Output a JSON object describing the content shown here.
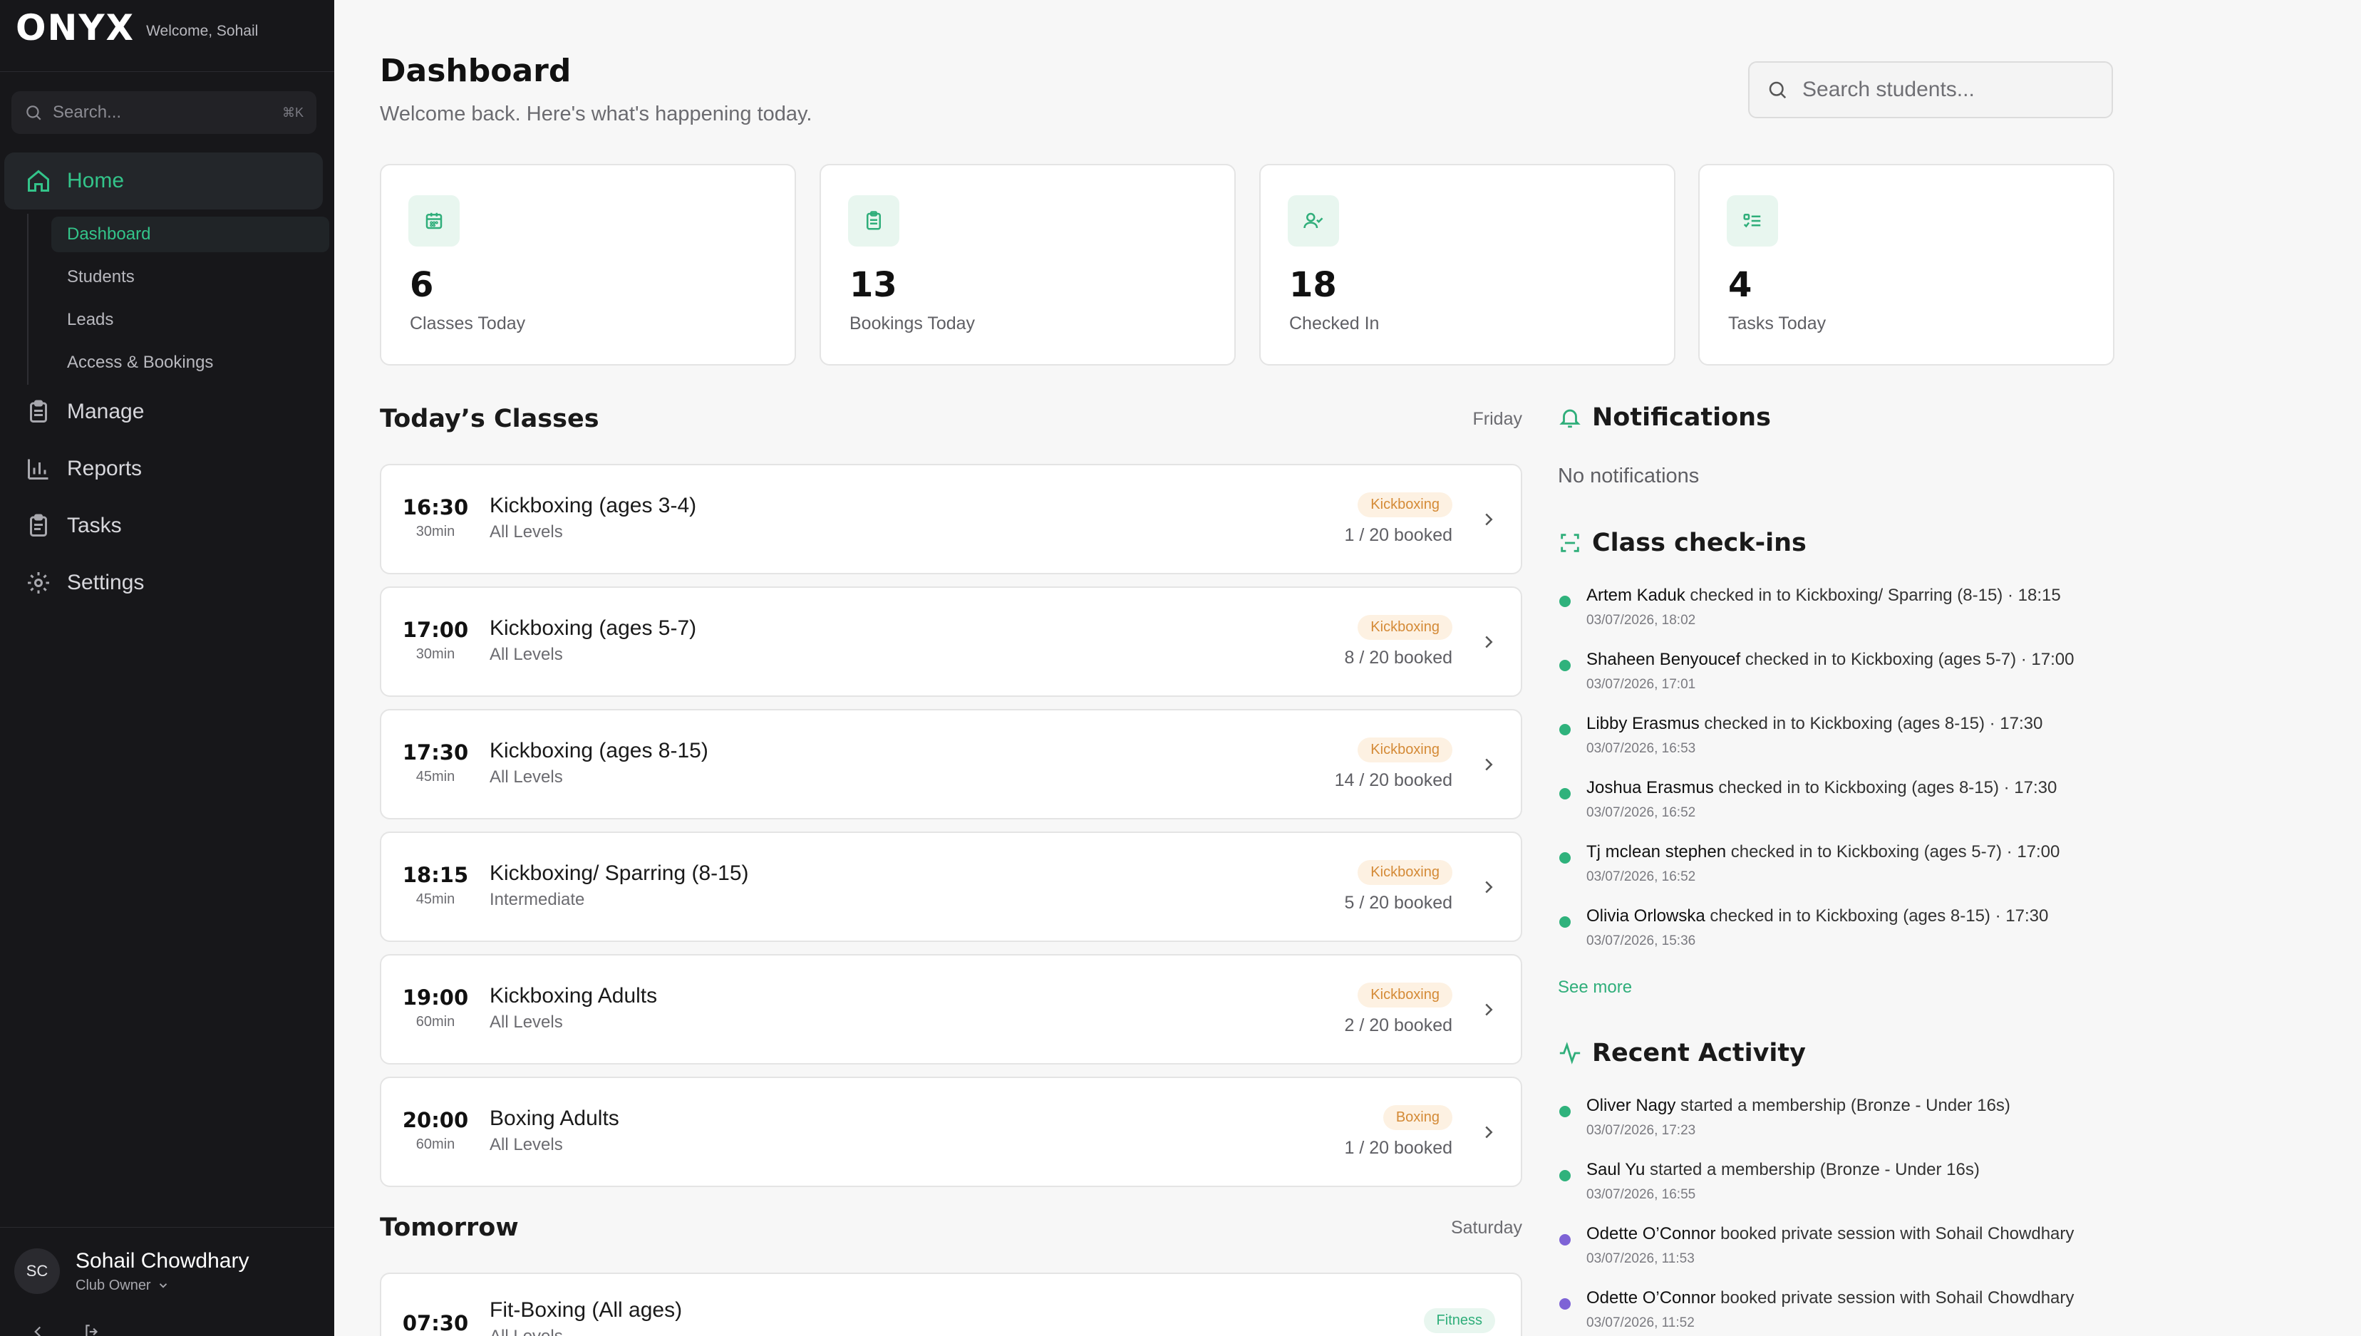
{
  "sidebar": {
    "logo": "ONYX",
    "welcome": "Welcome, Sohail",
    "search_placeholder": "Search...",
    "search_shortcut": "⌘K",
    "nav": [
      {
        "label": "Home"
      },
      {
        "label": "Manage"
      },
      {
        "label": "Reports"
      },
      {
        "label": "Tasks"
      },
      {
        "label": "Settings"
      }
    ],
    "sub": [
      {
        "label": "Dashboard"
      },
      {
        "label": "Students"
      },
      {
        "label": "Leads"
      },
      {
        "label": "Access & Bookings"
      }
    ],
    "user": {
      "initials": "SC",
      "name": "Sohail Chowdhary",
      "role": "Club Owner"
    }
  },
  "header": {
    "title": "Dashboard",
    "subtitle": "Welcome back. Here's what's happening today.",
    "search_placeholder": "Search students..."
  },
  "stats": [
    {
      "value": "6",
      "label": "Classes Today",
      "icon": "calendar-icon"
    },
    {
      "value": "13",
      "label": "Bookings Today",
      "icon": "clipboard-icon"
    },
    {
      "value": "18",
      "label": "Checked In",
      "icon": "user-check-icon"
    },
    {
      "value": "4",
      "label": "Tasks Today",
      "icon": "task-list-icon"
    }
  ],
  "today": {
    "title": "Today’s Classes",
    "day": "Friday",
    "classes": [
      {
        "time": "16:30",
        "duration": "30min",
        "name": "Kickboxing (ages 3-4)",
        "level": "All Levels",
        "tag": "Kickboxing",
        "booked": "1 / 20 booked"
      },
      {
        "time": "17:00",
        "duration": "30min",
        "name": "Kickboxing (ages 5-7)",
        "level": "All Levels",
        "tag": "Kickboxing",
        "booked": "8 / 20 booked"
      },
      {
        "time": "17:30",
        "duration": "45min",
        "name": "Kickboxing (ages 8-15)",
        "level": "All Levels",
        "tag": "Kickboxing",
        "booked": "14 / 20 booked"
      },
      {
        "time": "18:15",
        "duration": "45min",
        "name": "Kickboxing/ Sparring (8-15)",
        "level": "Intermediate",
        "tag": "Kickboxing",
        "booked": "5 / 20 booked"
      },
      {
        "time": "19:00",
        "duration": "60min",
        "name": "Kickboxing Adults",
        "level": "All Levels",
        "tag": "Kickboxing",
        "booked": "2 / 20 booked"
      },
      {
        "time": "20:00",
        "duration": "60min",
        "name": "Boxing Adults",
        "level": "All Levels",
        "tag": "Boxing",
        "booked": "1 / 20 booked"
      }
    ]
  },
  "tomorrow": {
    "title": "Tomorrow",
    "day": "Saturday",
    "classes": [
      {
        "time": "07:30",
        "name": "Fit-Boxing (All ages)",
        "level": "All Levels",
        "tag": "Fitness"
      }
    ]
  },
  "notifications": {
    "title": "Notifications",
    "empty": "No notifications"
  },
  "checkins": {
    "title": "Class check-ins",
    "see_more": "See more",
    "items": [
      {
        "name": "Artem Kaduk",
        "text": "checked in to Kickboxing/ Sparring (8-15) · 18:15",
        "ts": "03/07/2026, 18:02"
      },
      {
        "name": "Shaheen Benyoucef",
        "text": "checked in to Kickboxing (ages 5-7) · 17:00",
        "ts": "03/07/2026, 17:01"
      },
      {
        "name": "Libby Erasmus",
        "text": "checked in to Kickboxing (ages 8-15) · 17:30",
        "ts": "03/07/2026, 16:53"
      },
      {
        "name": "Joshua Erasmus",
        "text": "checked in to Kickboxing (ages 8-15) · 17:30",
        "ts": "03/07/2026, 16:52"
      },
      {
        "name": "Tj mclean stephen",
        "text": "checked in to Kickboxing (ages 5-7) · 17:00",
        "ts": "03/07/2026, 16:52"
      },
      {
        "name": "Olivia Orlowska",
        "text": "checked in to Kickboxing (ages 8-15) · 17:30",
        "ts": "03/07/2026, 15:36"
      }
    ]
  },
  "activity": {
    "title": "Recent Activity",
    "items": [
      {
        "name": "Oliver Nagy",
        "text": "started a membership (Bronze - Under 16s)",
        "ts": "03/07/2026, 17:23",
        "dot": "#2fb27c"
      },
      {
        "name": "Saul Yu",
        "text": "started a membership (Bronze - Under 16s)",
        "ts": "03/07/2026, 16:55",
        "dot": "#2fb27c"
      },
      {
        "name": "Odette O’Connor",
        "text": "booked private session with Sohail Chowdhary",
        "ts": "03/07/2026, 11:53",
        "dot": "#7e63d6"
      },
      {
        "name": "Odette O’Connor",
        "text": "booked private session with Sohail Chowdhary",
        "ts": "03/07/2026, 11:52",
        "dot": "#7e63d6"
      }
    ]
  },
  "colors": {
    "accent": "#33c48a",
    "sidebar_bg": "#17171a",
    "tag_orange": "#d48a36",
    "purple": "#7e63d6"
  }
}
